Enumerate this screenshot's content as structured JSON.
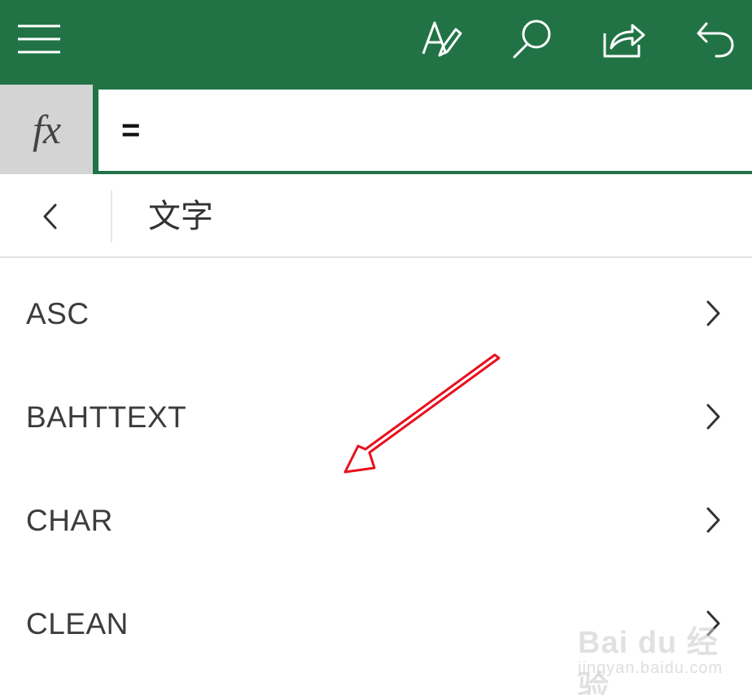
{
  "toolbar": {
    "icons": [
      "menu-icon",
      "edit-text-icon",
      "search-icon",
      "share-icon",
      "undo-icon"
    ],
    "background": "#217346"
  },
  "formula_bar": {
    "fx_label": "fx",
    "input_value": "="
  },
  "category": {
    "title": "文字",
    "back_icon": "chevron-left-icon"
  },
  "functions": [
    {
      "name": "ASC"
    },
    {
      "name": "BAHTTEXT"
    },
    {
      "name": "CHAR"
    },
    {
      "name": "CLEAN"
    }
  ],
  "annotation": {
    "color": "#e8101e",
    "icon": "red-arrow-annotation"
  },
  "watermark": {
    "brand": "Bai du 经验",
    "url": "jingyan.baidu.com"
  }
}
